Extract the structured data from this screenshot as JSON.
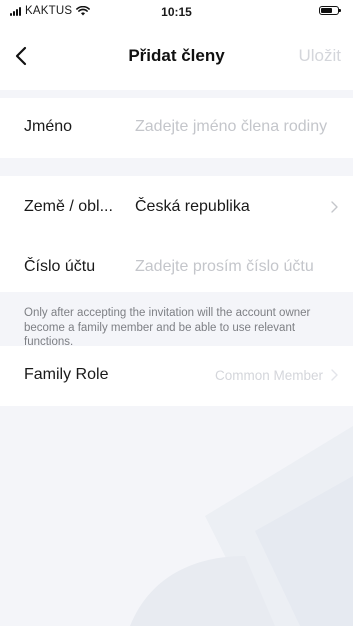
{
  "status_bar": {
    "carrier": "KAKTUS",
    "time": "10:15"
  },
  "header": {
    "title": "Přidat členy",
    "save_label": "Uložit"
  },
  "form": {
    "name": {
      "label": "Jméno",
      "placeholder": "Zadejte jméno člena rodiny"
    },
    "region": {
      "label": "Země / obl...",
      "value": "Česká republika"
    },
    "account": {
      "label": "Číslo účtu",
      "placeholder": "Zadejte prosím číslo účtu"
    },
    "note": "Only after accepting the invitation will the account owner become a family member and be able to use relevant functions.",
    "role": {
      "label": "Family Role",
      "value": "Common Member"
    }
  },
  "colors": {
    "background": "#f4f5f9",
    "card": "#ffffff",
    "placeholder": "#c4c6cb",
    "disabled": "#d4d6db",
    "watermark": "#e9ecf2"
  },
  "icons": {
    "back": "chevron-left-icon",
    "region_chevron": "chevron-right-icon",
    "role_chevron": "chevron-right-icon",
    "wifi": "wifi-icon",
    "battery": "battery-icon",
    "signal": "signal-icon"
  }
}
